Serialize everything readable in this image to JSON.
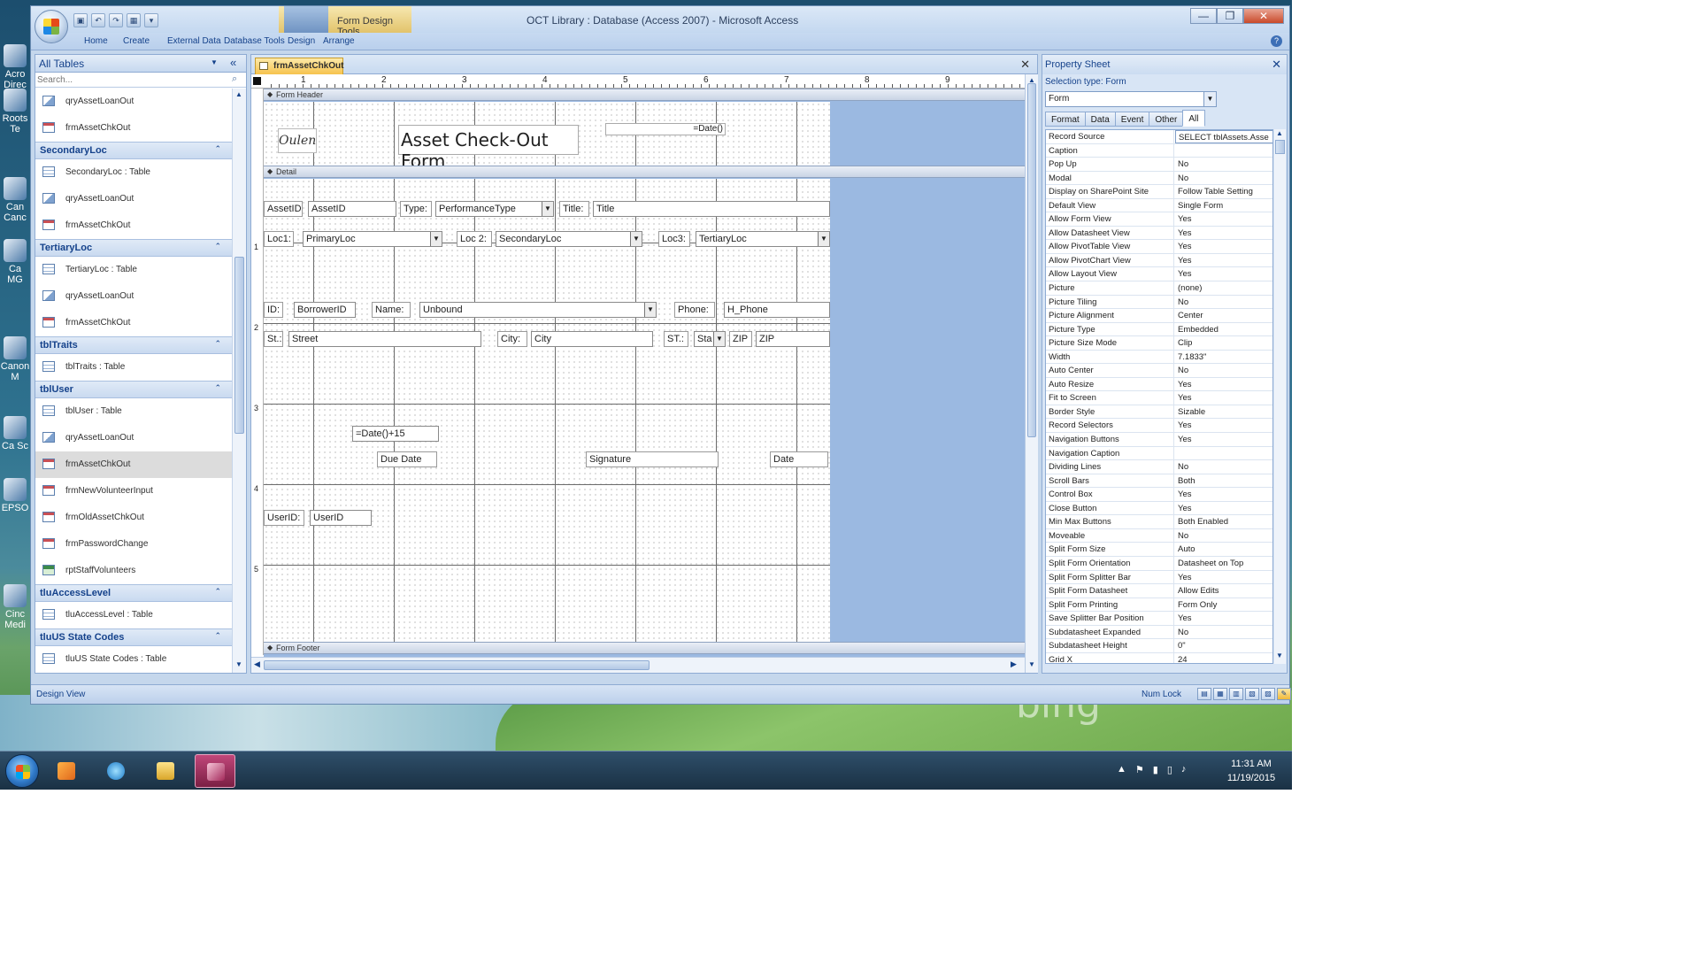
{
  "window": {
    "title": "OCT Library : Database (Access 2007) - Microsoft Access",
    "context_tab": "Form Design Tools",
    "controls": [
      "—",
      "❐",
      "✕"
    ]
  },
  "ribbon": {
    "tabs": [
      "Home",
      "Create",
      "External Data",
      "Database Tools",
      "Design",
      "Arrange"
    ]
  },
  "nav": {
    "title": "All Tables",
    "search_placeholder": "Search...",
    "entries": [
      {
        "kind": "item",
        "icon": "query",
        "label": "qryAssetLoanOut"
      },
      {
        "kind": "item",
        "icon": "form",
        "label": "frmAssetChkOut"
      },
      {
        "kind": "group",
        "label": "SecondaryLoc"
      },
      {
        "kind": "item",
        "icon": "table",
        "label": "SecondaryLoc : Table"
      },
      {
        "kind": "item",
        "icon": "query",
        "label": "qryAssetLoanOut"
      },
      {
        "kind": "item",
        "icon": "form",
        "label": "frmAssetChkOut"
      },
      {
        "kind": "group",
        "label": "TertiaryLoc"
      },
      {
        "kind": "item",
        "icon": "table",
        "label": "TertiaryLoc : Table"
      },
      {
        "kind": "item",
        "icon": "query",
        "label": "qryAssetLoanOut"
      },
      {
        "kind": "item",
        "icon": "form",
        "label": "frmAssetChkOut"
      },
      {
        "kind": "group",
        "label": "tblTraits"
      },
      {
        "kind": "item",
        "icon": "table",
        "label": "tblTraits : Table"
      },
      {
        "kind": "group",
        "label": "tblUser"
      },
      {
        "kind": "item",
        "icon": "table",
        "label": "tblUser : Table"
      },
      {
        "kind": "item",
        "icon": "query",
        "label": "qryAssetLoanOut"
      },
      {
        "kind": "item",
        "icon": "form",
        "label": "frmAssetChkOut",
        "selected": true
      },
      {
        "kind": "item",
        "icon": "form",
        "label": "frmNewVolunteerInput"
      },
      {
        "kind": "item",
        "icon": "form",
        "label": "frmOldAssetChkOut"
      },
      {
        "kind": "item",
        "icon": "form",
        "label": "frmPasswordChange"
      },
      {
        "kind": "item",
        "icon": "report",
        "label": "rptStaffVolunteers"
      },
      {
        "kind": "group",
        "label": "tluAccessLevel"
      },
      {
        "kind": "item",
        "icon": "table",
        "label": "tluAccessLevel : Table"
      },
      {
        "kind": "group",
        "label": "tluUS State Codes"
      },
      {
        "kind": "item",
        "icon": "table",
        "label": "tluUS State Codes : Table"
      }
    ]
  },
  "doc": {
    "tab": "frmAssetChkOut",
    "ruler_h": [
      "1",
      "2",
      "3",
      "4",
      "5",
      "6",
      "7",
      "8",
      "9"
    ],
    "ruler_v": [
      "1",
      "2",
      "3",
      "4",
      "5"
    ],
    "bands": {
      "header": "Form Header",
      "detail": "Detail",
      "footer": "Form Footer"
    },
    "header": {
      "title": "Asset Check-Out Form",
      "date_expr": "=Date()",
      "logo_text": "Oulen"
    },
    "controls": {
      "asset_id_label": "AssetID:",
      "asset_id": "AssetID",
      "type_label": "Type:",
      "type_value": "PerformanceType",
      "title_label": "Title:",
      "title_value": "Title",
      "loc1_label": "Loc1:",
      "loc1_value": "PrimaryLoc",
      "loc2_label": "Loc 2:",
      "loc2_value": "SecondaryLoc",
      "loc3_label": "Loc3:",
      "loc3_value": "TertiaryLoc",
      "id_label": "ID:",
      "borrower_id": "BorrowerID",
      "name_label": "Name:",
      "name_value": "Unbound",
      "phone_label": "Phone:",
      "phone_value": "H_Phone",
      "st_label": "St.:",
      "street_value": "Street",
      "city_label": "City:",
      "city_value": "City",
      "state_label": "ST.:",
      "state_value": "Sta",
      "zip_label": "ZIP",
      "zip_value": "ZIP",
      "due_expr": "=Date()+15",
      "due_date_label": "Due Date",
      "signature_label": "Signature",
      "date_label": "Date",
      "userid_label": "UserID:",
      "userid_value": "UserID"
    }
  },
  "props": {
    "title": "Property Sheet",
    "selection_type": "Selection type: Form",
    "selected_object": "Form",
    "tabs": [
      "Format",
      "Data",
      "Event",
      "Other",
      "All"
    ],
    "active_tab": "All",
    "rows": [
      {
        "name": "Record Source",
        "value": "SELECT tblAssets.Asse"
      },
      {
        "name": "Caption",
        "value": ""
      },
      {
        "name": "Pop Up",
        "value": "No"
      },
      {
        "name": "Modal",
        "value": "No"
      },
      {
        "name": "Display on SharePoint Site",
        "value": "Follow Table Setting"
      },
      {
        "name": "Default View",
        "value": "Single Form"
      },
      {
        "name": "Allow Form View",
        "value": "Yes"
      },
      {
        "name": "Allow Datasheet View",
        "value": "Yes"
      },
      {
        "name": "Allow PivotTable View",
        "value": "Yes"
      },
      {
        "name": "Allow PivotChart View",
        "value": "Yes"
      },
      {
        "name": "Allow Layout View",
        "value": "Yes"
      },
      {
        "name": "Picture",
        "value": "(none)"
      },
      {
        "name": "Picture Tiling",
        "value": "No"
      },
      {
        "name": "Picture Alignment",
        "value": "Center"
      },
      {
        "name": "Picture Type",
        "value": "Embedded"
      },
      {
        "name": "Picture Size Mode",
        "value": "Clip"
      },
      {
        "name": "Width",
        "value": "7.1833\""
      },
      {
        "name": "Auto Center",
        "value": "No"
      },
      {
        "name": "Auto Resize",
        "value": "Yes"
      },
      {
        "name": "Fit to Screen",
        "value": "Yes"
      },
      {
        "name": "Border Style",
        "value": "Sizable"
      },
      {
        "name": "Record Selectors",
        "value": "Yes"
      },
      {
        "name": "Navigation Buttons",
        "value": "Yes"
      },
      {
        "name": "Navigation Caption",
        "value": ""
      },
      {
        "name": "Dividing Lines",
        "value": "No"
      },
      {
        "name": "Scroll Bars",
        "value": "Both"
      },
      {
        "name": "Control Box",
        "value": "Yes"
      },
      {
        "name": "Close Button",
        "value": "Yes"
      },
      {
        "name": "Min Max Buttons",
        "value": "Both Enabled"
      },
      {
        "name": "Moveable",
        "value": "No"
      },
      {
        "name": "Split Form Size",
        "value": "Auto"
      },
      {
        "name": "Split Form Orientation",
        "value": "Datasheet on Top"
      },
      {
        "name": "Split Form Splitter Bar",
        "value": "Yes"
      },
      {
        "name": "Split Form Datasheet",
        "value": "Allow Edits"
      },
      {
        "name": "Split Form Printing",
        "value": "Form Only"
      },
      {
        "name": "Save Splitter Bar Position",
        "value": "Yes"
      },
      {
        "name": "Subdatasheet Expanded",
        "value": "No"
      },
      {
        "name": "Subdatasheet Height",
        "value": "0\""
      },
      {
        "name": "Grid X",
        "value": "24"
      }
    ]
  },
  "status": {
    "view": "Design View",
    "numlock": "Num Lock"
  },
  "desktop": {
    "icons": [
      "Acro Direc",
      "Roots Te",
      "Can Canc",
      "Ca MG",
      "Canon M",
      "Ca Sc",
      "EPSO",
      "Cinc Medi"
    ],
    "bing_text": "bing"
  },
  "taskbar": {
    "time": "11:31 AM",
    "date": "11/19/2015"
  }
}
